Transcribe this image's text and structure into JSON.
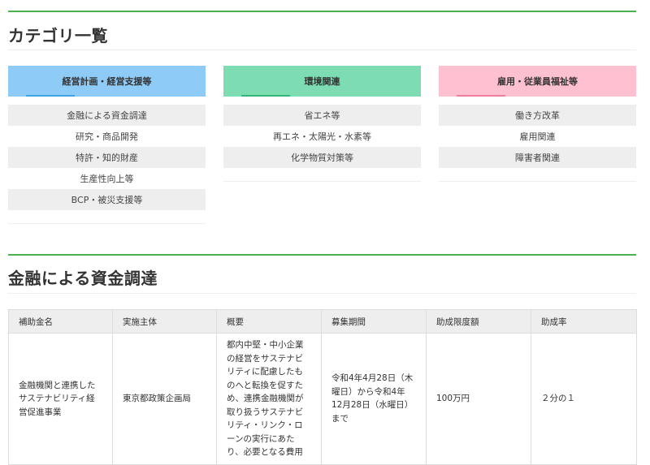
{
  "category_section": {
    "title": "カテゴリ一覧",
    "columns": [
      {
        "header": "経営計画・経営支援等",
        "header_color": "#8ecbf7",
        "accent_color": "#3da2e6",
        "items": [
          "金融による資金調達",
          "研究・商品開発",
          "特許・知的財産",
          "生産性向上等",
          "BCP・被災支援等"
        ]
      },
      {
        "header": "環境関連",
        "header_color": "#7ddcb2",
        "accent_color": "#32b77b",
        "items": [
          "省エネ等",
          "再エネ・太陽光・水素等",
          "化学物質対策等"
        ]
      },
      {
        "header": "雇用・従業員福祉等",
        "header_color": "#ffc1d1",
        "accent_color": "#ef7d9f",
        "items": [
          "働き方改革",
          "雇用関連",
          "障害者関連"
        ]
      }
    ]
  },
  "finance_section": {
    "title": "金融による資金調達",
    "table": {
      "headers": [
        "補助金名",
        "実施主体",
        "概要",
        "募集期間",
        "助成限度額",
        "助成率"
      ],
      "rows": [
        {
          "name": "金融機関と連携したサステナビリティ経営促進事業",
          "org": "東京都政策企画局",
          "summary": "都内中堅・中小企業の経営をサステナビリティに配慮したものへと転換を促すため、連携金融機関が取り扱うサステナビリティ・リンク・ローンの実行にあたり、必要となる費用",
          "period": "令和4年4月28日（木曜日）から令和4年12月28日（水曜日）まで",
          "limit": "100万円",
          "rate": "２分の１"
        }
      ]
    }
  }
}
